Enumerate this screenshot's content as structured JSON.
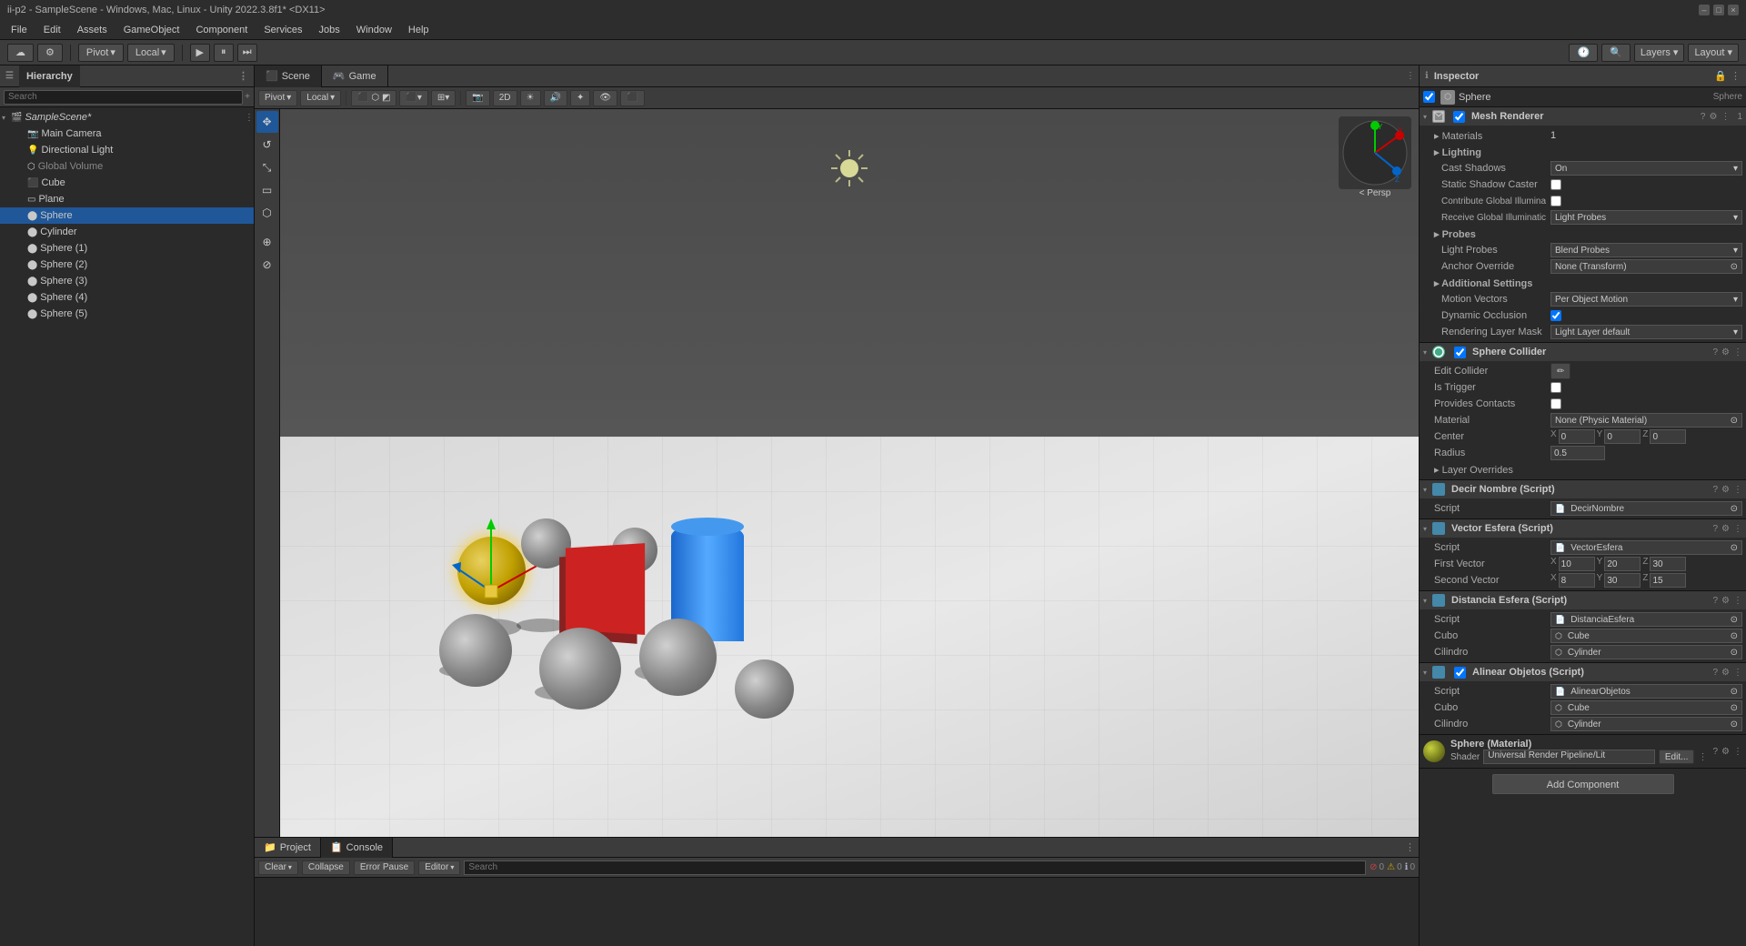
{
  "titleBar": {
    "title": "ii-p2 - SampleScene - Windows, Mac, Linux - Unity 2022.3.8f1* <DX11>",
    "controls": [
      "minimize",
      "maximize",
      "close"
    ]
  },
  "menuBar": {
    "items": [
      "File",
      "Edit",
      "Assets",
      "GameObject",
      "Component",
      "Services",
      "Jobs",
      "Window",
      "Help"
    ]
  },
  "toolbar": {
    "pivotLabel": "Pivot",
    "localLabel": "Local",
    "playBtn": "▶",
    "pauseBtn": "⏸",
    "nextBtn": "⏭",
    "layersLabel": "Layers",
    "layoutLabel": "Layout"
  },
  "hierarchy": {
    "title": "Hierarchy",
    "searchPlaceholder": "Search",
    "items": [
      {
        "id": "samplescene",
        "name": "SampleScene*",
        "level": 0,
        "hasChildren": true,
        "modified": true
      },
      {
        "id": "maincamera",
        "name": "Main Camera",
        "level": 1,
        "hasChildren": false
      },
      {
        "id": "directionallight",
        "name": "Directional Light",
        "level": 1,
        "hasChildren": false
      },
      {
        "id": "globalvolume",
        "name": "Global Volume",
        "level": 1,
        "hasChildren": false,
        "grayed": true
      },
      {
        "id": "cube",
        "name": "Cube",
        "level": 1,
        "hasChildren": false
      },
      {
        "id": "plane",
        "name": "Plane",
        "level": 1,
        "hasChildren": false
      },
      {
        "id": "sphere",
        "name": "Sphere",
        "level": 1,
        "hasChildren": false,
        "selected": true
      },
      {
        "id": "cylinder",
        "name": "Cylinder",
        "level": 1,
        "hasChildren": false
      },
      {
        "id": "sphere1",
        "name": "Sphere (1)",
        "level": 1,
        "hasChildren": false
      },
      {
        "id": "sphere2",
        "name": "Sphere (2)",
        "level": 1,
        "hasChildren": false
      },
      {
        "id": "sphere3",
        "name": "Sphere (3)",
        "level": 1,
        "hasChildren": false
      },
      {
        "id": "sphere4",
        "name": "Sphere (4)",
        "level": 1,
        "hasChildren": false
      },
      {
        "id": "sphere5",
        "name": "Sphere (5)",
        "level": 1,
        "hasChildren": false
      }
    ]
  },
  "sceneView": {
    "tabs": [
      "Scene",
      "Game"
    ],
    "activeTab": "Scene",
    "toolbar": {
      "pivot": "Pivot",
      "local": "Local",
      "mode2D": "2D",
      "persp": "< Persp"
    }
  },
  "inspector": {
    "title": "Inspector",
    "objectName": "Sphere",
    "objectTag": "Sphere",
    "sections": {
      "meshRenderer": {
        "title": "Mesh Renderer",
        "count": 1,
        "materials": {
          "label": "Materials",
          "count": "1"
        },
        "lighting": {
          "label": "Lighting",
          "castShadows": {
            "label": "Cast Shadows",
            "value": "On"
          },
          "staticShadowCaster": {
            "label": "Static Shadow Caster",
            "value": ""
          },
          "contributeGI": {
            "label": "Contribute Global Illumina",
            "value": ""
          },
          "receiveGI": {
            "label": "Receive Global Illuminatic",
            "value": "Light Probes"
          }
        },
        "probes": {
          "label": "Probes",
          "lightProbes": {
            "label": "Light Probes",
            "value": "Blend Probes"
          },
          "anchorOverride": {
            "label": "Anchor Override",
            "value": "None (Transform)"
          }
        },
        "additionalSettings": {
          "label": "Additional Settings",
          "motionVectors": {
            "label": "Motion Vectors",
            "value": "Per Object Motion"
          },
          "dynamicOcclusion": {
            "label": "Dynamic Occlusion",
            "value": true
          },
          "renderingLayerMask": {
            "label": "Rendering Layer Mask",
            "value": "Light Layer default"
          }
        }
      },
      "sphereCollider": {
        "title": "Sphere Collider",
        "editCollider": {
          "label": "Edit Collider"
        },
        "isTrigger": {
          "label": "Is Trigger",
          "value": false
        },
        "providesContacts": {
          "label": "Provides Contacts",
          "value": false
        },
        "material": {
          "label": "Material",
          "value": "None (Physic Material)"
        },
        "center": {
          "label": "Center",
          "x": "0",
          "y": "0",
          "z": "0"
        },
        "radius": {
          "label": "Radius",
          "value": "0.5"
        },
        "layerOverrides": {
          "label": "Layer Overrides"
        }
      },
      "decirNombre": {
        "title": "Decir Nombre (Script)",
        "script": {
          "label": "Script",
          "value": "DecirNombre"
        }
      },
      "vectorEsfera": {
        "title": "Vector Esfera (Script)",
        "script": {
          "label": "Script",
          "value": "VectorEsfera"
        },
        "firstVector": {
          "label": "First Vector",
          "x": "10",
          "y": "20",
          "z": "30"
        },
        "secondVector": {
          "label": "Second Vector",
          "x": "8",
          "y": "30",
          "z": "15"
        }
      },
      "distanciaEsfera": {
        "title": "Distancia Esfera (Script)",
        "script": {
          "label": "Script",
          "value": "DistanciaEsfera"
        },
        "cubo": {
          "label": "Cubo",
          "value": "Cube"
        },
        "cilindro": {
          "label": "Cilindro",
          "value": "Cylinder"
        }
      },
      "alinearObjetos": {
        "title": "Alinear Objetos (Script)",
        "script": {
          "label": "Script",
          "value": "AlinearObjetos"
        },
        "cubo": {
          "label": "Cubo",
          "value": "Cube"
        },
        "cilindro": {
          "label": "Cilindro",
          "value": "Cylinder"
        }
      },
      "material": {
        "name": "Sphere (Material)",
        "shader": {
          "label": "Shader",
          "value": "Universal Render Pipeline/Lit"
        },
        "editBtn": "Edit...",
        "addComponentBtn": "Add Component"
      }
    }
  },
  "console": {
    "tabs": [
      "Project",
      "Console"
    ],
    "activeTab": "Console",
    "toolbar": {
      "clearLabel": "Clear",
      "collapseLabel": "Collapse",
      "errorPauseLabel": "Error Pause",
      "editorLabel": "Editor"
    },
    "badges": {
      "errors": "0",
      "warnings": "0",
      "logs": "0"
    }
  }
}
